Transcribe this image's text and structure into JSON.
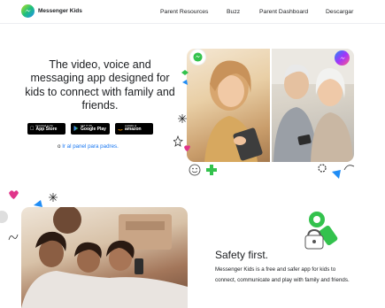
{
  "nav": {
    "brand": "Messenger Kids",
    "links": [
      "Parent Resources",
      "Buzz",
      "Parent Dashboard",
      "Descargar"
    ]
  },
  "hero": {
    "title": "The video, voice and messaging app designed for kids to connect with family and friends.",
    "stores": [
      {
        "small": "Download on the",
        "big": "App Store",
        "icon": "apple-icon"
      },
      {
        "small": "GET IT ON",
        "big": "Google Play",
        "icon": "play-icon"
      },
      {
        "small": "available at",
        "big": "amazon",
        "icon": "amazon-icon"
      }
    ],
    "panel_prefix": "o",
    "panel_link": "Ir al panel para padres."
  },
  "safety": {
    "title": "Safety first.",
    "text": "Messenger Kids is a free and safer app for kids to connect, communicate and play with family and friends."
  },
  "colors": {
    "link": "#1877f2",
    "accent_green": "#33c24d",
    "accent_pink": "#e0358a",
    "accent_blue": "#1f8cf5"
  }
}
